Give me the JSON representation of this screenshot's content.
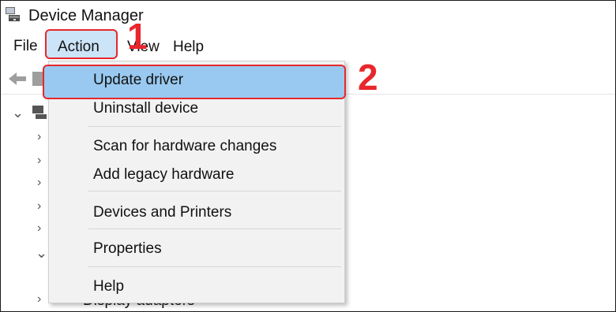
{
  "window": {
    "title": "Device Manager"
  },
  "menubar": {
    "items": [
      {
        "label": "File"
      },
      {
        "label": "Action"
      },
      {
        "label": "View"
      },
      {
        "label": "Help"
      }
    ]
  },
  "action_menu": {
    "items": [
      {
        "label": "Update driver",
        "highlighted": true
      },
      {
        "label": "Uninstall device"
      },
      {
        "label": "Scan for hardware changes"
      },
      {
        "label": "Add legacy hardware"
      },
      {
        "label": "Devices and Printers"
      },
      {
        "label": "Properties"
      },
      {
        "label": "Help"
      }
    ]
  },
  "tree": {
    "partially_visible_item": "Display adapters"
  },
  "annotations": [
    {
      "label": "1",
      "color": "#e8272c"
    },
    {
      "label": "2",
      "color": "#e8272c"
    }
  ],
  "colors": {
    "highlight": "#99c9f0",
    "annotation": "#e8272c",
    "menu_bg": "#f2f2f2"
  }
}
